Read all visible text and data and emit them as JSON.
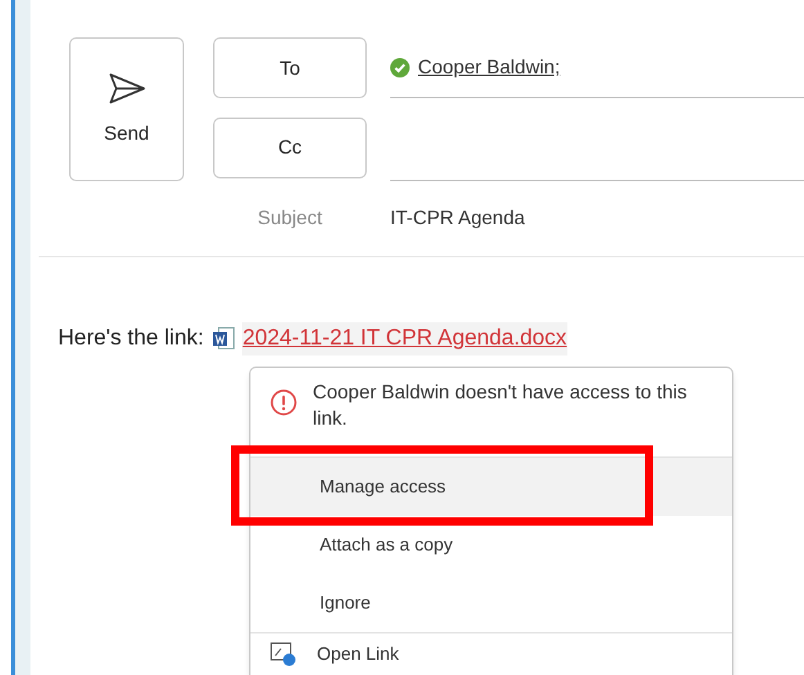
{
  "compose": {
    "send_button": "Send",
    "to_button": "To",
    "cc_button": "Cc",
    "recipient": {
      "name": "Cooper Baldwin;",
      "resolved": true
    },
    "subject_label": "Subject",
    "subject": "IT-CPR Agenda"
  },
  "body": {
    "text": "Here's the link:",
    "link": "2024-11-21 IT CPR Agenda.docx"
  },
  "menu": {
    "items": [
      {
        "kind": "warning",
        "label": "Cooper Baldwin doesn't have access to this link."
      },
      {
        "kind": "action",
        "label": "Manage access",
        "selected": true,
        "annotated": true
      },
      {
        "kind": "action",
        "label": "Attach as a copy",
        "selected": false,
        "annotated": false
      },
      {
        "kind": "action",
        "label": "Ignore",
        "selected": false,
        "annotated": false
      },
      {
        "kind": "link",
        "label": "Open Link",
        "selected": false,
        "annotated": false
      }
    ]
  }
}
